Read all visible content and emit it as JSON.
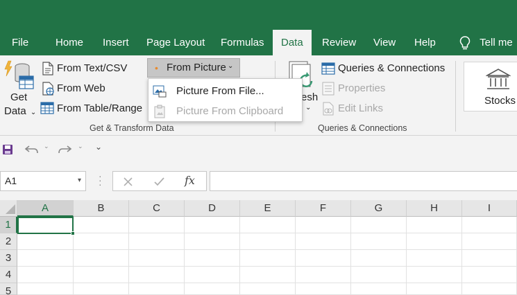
{
  "tabs": [
    {
      "id": "file",
      "label": "File"
    },
    {
      "id": "home",
      "label": "Home"
    },
    {
      "id": "insert",
      "label": "Insert"
    },
    {
      "id": "page-layout",
      "label": "Page Layout"
    },
    {
      "id": "formulas",
      "label": "Formulas"
    },
    {
      "id": "data",
      "label": "Data",
      "active": true
    },
    {
      "id": "review",
      "label": "Review"
    },
    {
      "id": "view",
      "label": "View"
    },
    {
      "id": "help",
      "label": "Help"
    }
  ],
  "tell_me": "Tell me",
  "ribbon": {
    "get_transform": {
      "get_data_line1": "Get",
      "get_data_line2": "Data",
      "from_text_csv": "From Text/CSV",
      "from_web": "From Web",
      "from_table_range": "From Table/Range",
      "from_picture": "From Picture",
      "group_label": "Get & Transform Data"
    },
    "queries": {
      "refresh_partial": "esh",
      "queries_connections": "Queries & Connections",
      "properties": "Properties",
      "edit_links": "Edit Links",
      "group_label": "Queries & Connections"
    },
    "data_types": {
      "stocks": "Stocks"
    }
  },
  "dropdown": {
    "items": [
      {
        "label": "Picture From File...",
        "enabled": true
      },
      {
        "label": "Picture From Clipboard",
        "enabled": false
      }
    ]
  },
  "formula_bar": {
    "name_box": "A1",
    "formula": ""
  },
  "grid": {
    "columns": [
      "A",
      "B",
      "C",
      "D",
      "E",
      "F",
      "G",
      "H",
      "I"
    ],
    "rows": [
      "1",
      "2",
      "3",
      "4",
      "5"
    ],
    "active_cell": "A1"
  },
  "colors": {
    "brand": "#217346",
    "ribbon_bg": "#f3f3f3"
  }
}
